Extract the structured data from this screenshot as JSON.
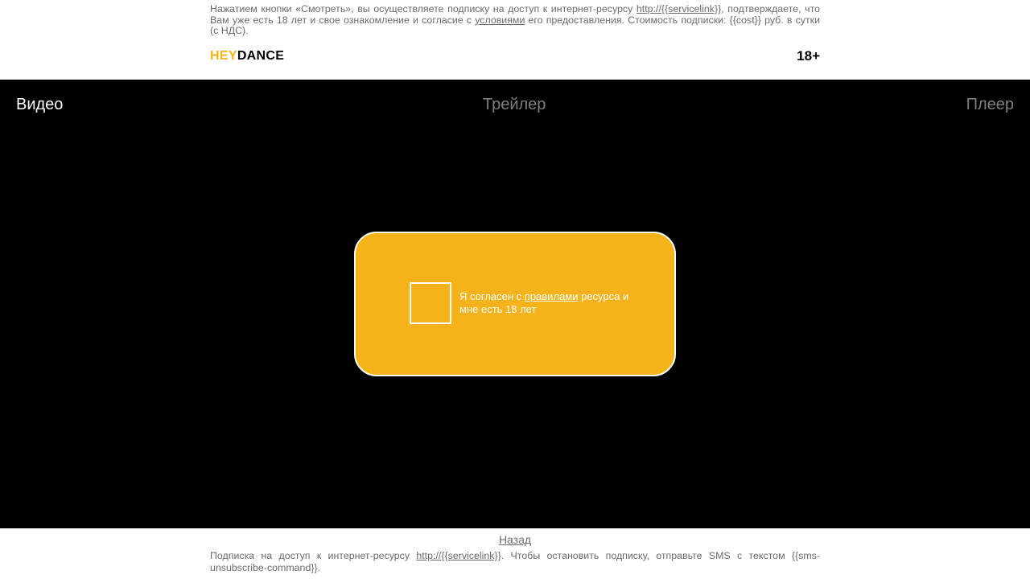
{
  "header": {
    "notice": {
      "part1": "Нажатием кнопки «Смотреть», вы осуществляете подписку на доступ к интернет-ресурсу ",
      "service_link": "http://{{servicelink}}",
      "part2": ", подтверждаете, что Вам уже есть 18 лет и свое ознакомление и согласие с ",
      "terms_link": "условиями",
      "part3": " его предоставления. Стоимость подписки: {{cost}} руб. в сутки (с НДС)."
    },
    "logo": {
      "hey": "HEY",
      "dance": "DANCE"
    },
    "age_rating": "18+"
  },
  "tabs": {
    "video": "Видео",
    "trailer": "Трейлер",
    "player": "Плеер"
  },
  "consent": {
    "text_before": "Я согласен с ",
    "rules_link": "правилами",
    "text_after": " ресурса и мне есть 18 лет",
    "checked": false
  },
  "footer": {
    "back_link": "Назад",
    "notice": {
      "part1": "Подписка на доступ к интернет-ресурсу ",
      "service_link": "http://{{servicelink}}",
      "part2": ". Чтобы остановить подписку, отправьте SMS с текстом {{sms-unsubscribe-command}}."
    }
  },
  "colors": {
    "accent": "#f5b21b",
    "background_dark": "#000000",
    "muted_text": "#6b6b6b",
    "inactive_tab": "#7f7f7f"
  }
}
